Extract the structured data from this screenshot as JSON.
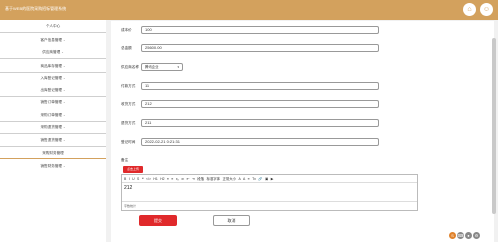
{
  "header": {
    "title": "基于WEB的医院采购招标管理系统",
    "icons": [
      "home-icon",
      "user-icon"
    ],
    "accent": "#d3a15d"
  },
  "sidebar": {
    "items": [
      {
        "label": "个人中心",
        "has_chevron": true
      },
      {
        "label": "客户信息管理",
        "has_chevron": true
      },
      {
        "label": "供应商管理",
        "has_chevron": true
      },
      {
        "label": "商品库存管理",
        "has_chevron": true
      },
      {
        "label": "入库登记管理",
        "has_chevron": true
      },
      {
        "label": "出库登记管理",
        "has_chevron": true
      },
      {
        "label": "销售订单管理",
        "has_chevron": true
      },
      {
        "label": "采购订单管理",
        "has_chevron": true
      },
      {
        "label": "采购退货管理",
        "has_chevron": true
      },
      {
        "label": "销售退货管理",
        "has_chevron": true
      },
      {
        "label": "采购财务管理",
        "has_chevron": false
      },
      {
        "label": "销售财务管理",
        "has_chevron": true
      }
    ]
  },
  "form": {
    "fields": [
      {
        "label": "成本价",
        "value": "100"
      },
      {
        "label": "总金额",
        "value": "25600.00"
      },
      {
        "label": "供应商名称",
        "value": "腾讯企业",
        "type": "select"
      },
      {
        "label": "付款方式",
        "value": "11"
      },
      {
        "label": "收货方式",
        "value": "212"
      },
      {
        "label": "退货方式",
        "value": "211"
      },
      {
        "label": "登记时间",
        "value": "2022-02-21 0:21:31"
      }
    ],
    "remark_label": "备注",
    "upload_label": "点击上传",
    "toolbar_items": [
      "B",
      "I",
      "U",
      "S",
      "❝",
      "</>",
      "H1",
      "H2",
      "≡",
      "≡",
      "x₂",
      "x²",
      "⇤",
      "⇥",
      "段落",
      "标准字体",
      "正常大小",
      "A",
      "A",
      "≡",
      "Tx",
      "🔗",
      "▣",
      "▶"
    ],
    "toolbar_labels": {
      "paragraph": "段落",
      "font": "标准字体",
      "size": "正常大小"
    },
    "editor_text": "212",
    "editor_footer": "字数统计",
    "submit_label": "提交",
    "cancel_label": "取消",
    "submit_color": "#e0292b"
  }
}
